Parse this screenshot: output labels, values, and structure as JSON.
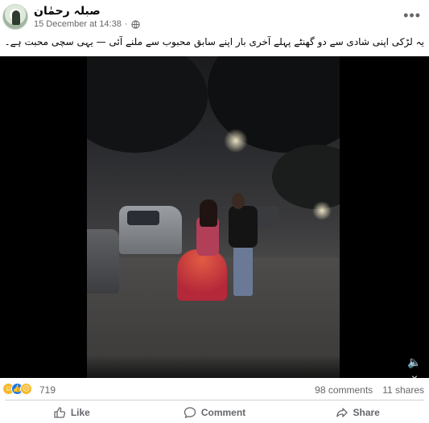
{
  "post": {
    "author": "صبلہ رحمٰان",
    "timestamp": "15 December at 14:38",
    "separator": "·",
    "privacy_icon": "globe-icon",
    "more_icon": "more-options-icon",
    "more_label": "•••",
    "caption": "یہ لڑکی اپنی شادی سے دو گھنٹے پہلے آخری بار اپنے سابق محبوب سے ملنے آئی — یہی سچی محبت ہے۔"
  },
  "video": {
    "mute_icon": "speaker-muted-icon",
    "mute_label": "🔈×"
  },
  "reactions": {
    "icons": [
      "haha-reaction-icon",
      "like-reaction-icon",
      "sad-reaction-icon"
    ],
    "count": "719",
    "comments": "98 comments",
    "shares": "11 shares"
  },
  "actions": [
    {
      "label": "Like",
      "icon": "thumbs-up-icon"
    },
    {
      "label": "Comment",
      "icon": "comment-bubble-icon"
    },
    {
      "label": "Share",
      "icon": "share-arrow-icon"
    }
  ],
  "colors": {
    "text_primary": "#050505",
    "text_secondary": "#65676b",
    "like_blue": "#1877f2",
    "divider": "#ced0d4"
  }
}
